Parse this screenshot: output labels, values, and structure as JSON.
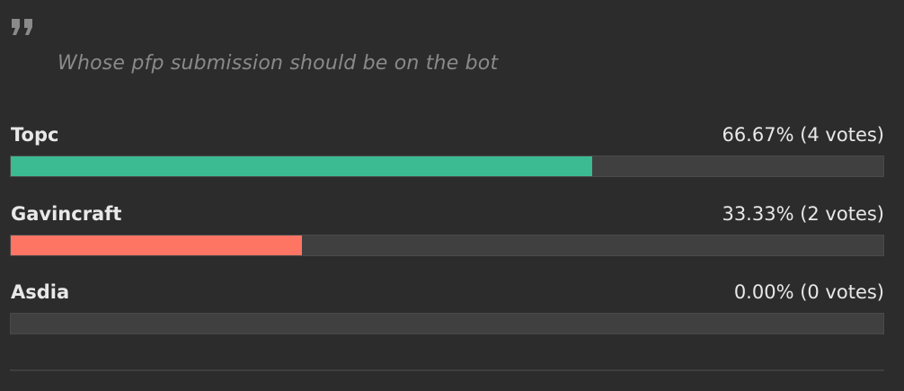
{
  "poll": {
    "icon": "quote-icon",
    "question": "Whose pfp submission should be on the bot",
    "options": [
      {
        "label": "Topc",
        "result": "66.67% (4 votes)",
        "percent": 66.67,
        "color": "#3cba92"
      },
      {
        "label": "Gavincraft",
        "result": "33.33% (2 votes)",
        "percent": 33.33,
        "color": "#ff7563"
      },
      {
        "label": "Asdia",
        "result": "0.00% (0 votes)",
        "percent": 0,
        "color": "#6a6a6a"
      }
    ]
  }
}
